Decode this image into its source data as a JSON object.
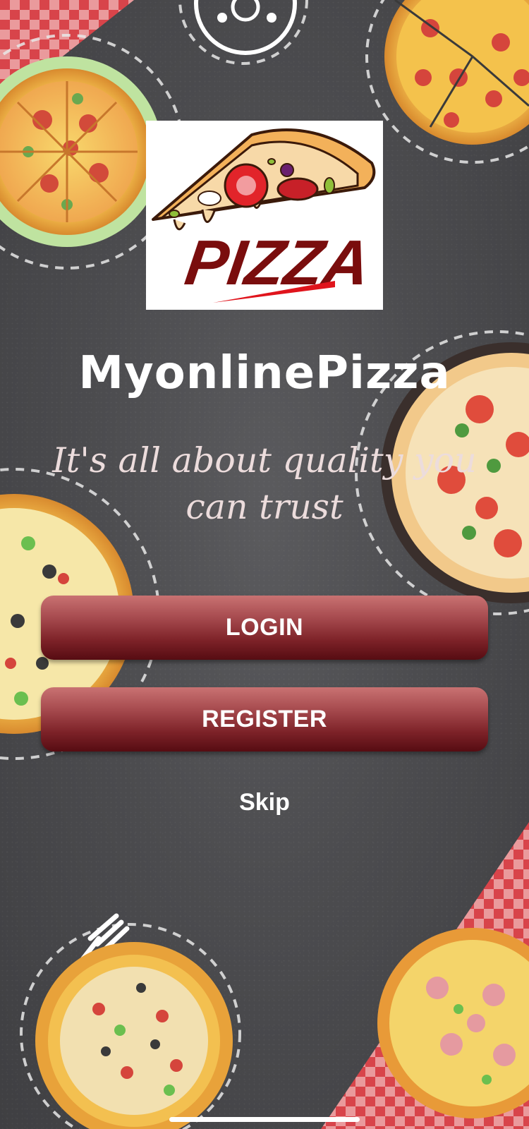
{
  "app": {
    "title": "MyonlinePizza",
    "tagline": "It's all about quality you can trust"
  },
  "logo": {
    "text": "PIZZA"
  },
  "actions": {
    "login_label": "LOGIN",
    "register_label": "REGISTER",
    "skip_label": "Skip"
  },
  "colors": {
    "button_top": "#c97272",
    "button_bottom": "#560c12",
    "logo_text": "#7a0d0d",
    "background": "#4a4a4c"
  },
  "icons": {
    "logo": "pizza-slice-icon",
    "decor": [
      "pizza-icon",
      "fork-icon",
      "checkered-cloth"
    ]
  }
}
